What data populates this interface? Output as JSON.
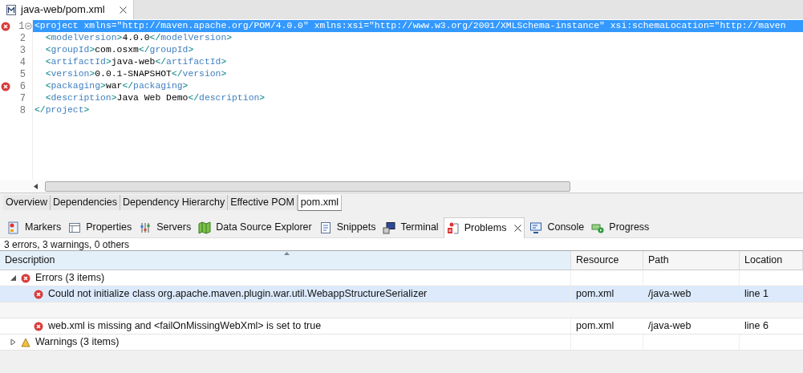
{
  "editor_tab": {
    "title": "java-web/pom.xml"
  },
  "code_lines": [
    {
      "number": "1",
      "text": "<project xmlns=\"http://maven.apache.org/POM/4.0.0\" xmlns:xsi=\"http://www.w3.org/2001/XMLSchema-instance\" xsi:schemaLocation=\"http://maven",
      "error": true,
      "selected": true,
      "foldable": true
    },
    {
      "number": "2",
      "text": "  <modelVersion>4.0.0</modelVersion>",
      "error": false,
      "selected": false,
      "foldable": false
    },
    {
      "number": "3",
      "text": "  <groupId>com.osxm</groupId>",
      "error": false,
      "selected": false,
      "foldable": false
    },
    {
      "number": "4",
      "text": "  <artifactId>java-web</artifactId>",
      "error": false,
      "selected": false,
      "foldable": false
    },
    {
      "number": "5",
      "text": "  <version>0.0.1-SNAPSHOT</version>",
      "error": false,
      "selected": false,
      "foldable": false
    },
    {
      "number": "6",
      "text": "  <packaging>war</packaging>",
      "error": true,
      "selected": false,
      "foldable": false
    },
    {
      "number": "7",
      "text": "  <description>Java Web Demo</description>",
      "error": false,
      "selected": false,
      "foldable": false
    },
    {
      "number": "8",
      "text": "</project>",
      "error": false,
      "selected": false,
      "foldable": false
    }
  ],
  "page_tabs": [
    {
      "label": "Overview",
      "selected": false
    },
    {
      "label": "Dependencies",
      "selected": false
    },
    {
      "label": "Dependency Hierarchy",
      "selected": false
    },
    {
      "label": "Effective POM",
      "selected": false
    },
    {
      "label": "pom.xml",
      "selected": true
    }
  ],
  "view_tabs": [
    {
      "label": "Markers",
      "kind": "markers",
      "selected": false
    },
    {
      "label": "Properties",
      "kind": "properties",
      "selected": false
    },
    {
      "label": "Servers",
      "kind": "servers",
      "selected": false
    },
    {
      "label": "Data Source Explorer",
      "kind": "datasource",
      "selected": false
    },
    {
      "label": "Snippets",
      "kind": "snippets",
      "selected": false
    },
    {
      "label": "Terminal",
      "kind": "terminal",
      "selected": false
    },
    {
      "label": "Problems",
      "kind": "problems",
      "selected": true
    },
    {
      "label": "Console",
      "kind": "console",
      "selected": false
    },
    {
      "label": "Progress",
      "kind": "progress",
      "selected": false
    }
  ],
  "problems": {
    "summary": "3 errors, 3 warnings, 0 others",
    "columns": [
      "Description",
      "Resource",
      "Path",
      "Location"
    ],
    "groups": [
      {
        "label": "Errors (3 items)",
        "kind": "error",
        "expanded": true,
        "rows": [
          {
            "description": "Could not initialize class org.apache.maven.plugin.war.util.WebappStructureSerializer",
            "resource": "pom.xml",
            "path": "/java-web",
            "location": "line 1",
            "selected": true
          },
          {
            "description": "web.xml is missing and <failOnMissingWebXml> is set to true",
            "resource": "pom.xml",
            "path": "/java-web",
            "location": "line 6",
            "selected": false
          }
        ]
      },
      {
        "label": "Warnings (3 items)",
        "kind": "warning",
        "expanded": false
      }
    ]
  }
}
